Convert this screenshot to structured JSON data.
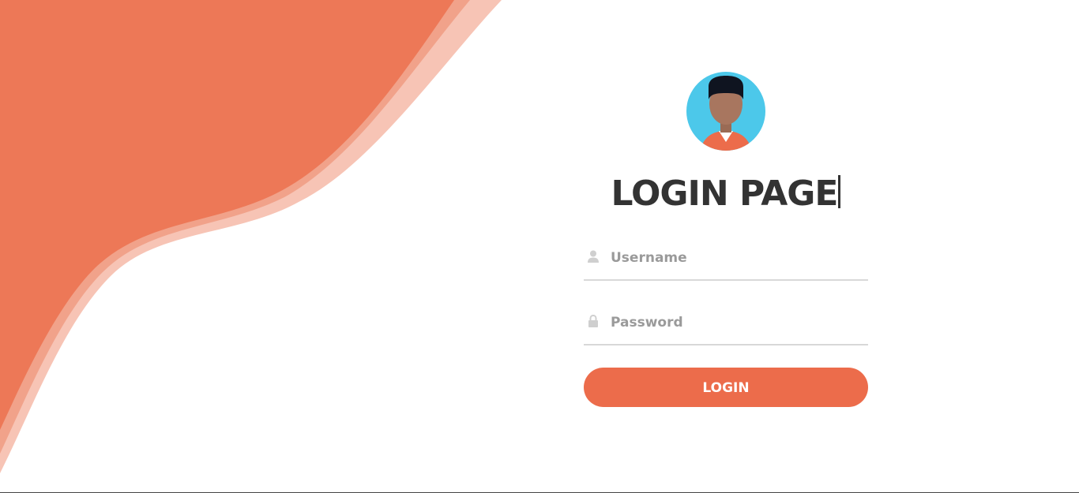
{
  "colors": {
    "accent": "#ec6c4b",
    "wave_main": "#ed7857",
    "wave_light": "#f6c3b4",
    "avatar_bg": "#4cc8ea",
    "title": "#333333"
  },
  "header": {
    "title": "LOGIN PAGE"
  },
  "form": {
    "username": {
      "icon": "user-icon",
      "placeholder": "Username",
      "value": ""
    },
    "password": {
      "icon": "lock-icon",
      "placeholder": "Password",
      "value": ""
    },
    "login_label": "LOGIN"
  }
}
